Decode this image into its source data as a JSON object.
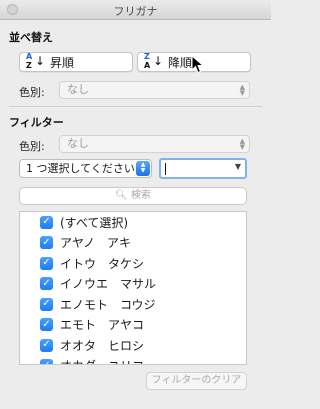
{
  "window": {
    "title": "フリガナ"
  },
  "sort": {
    "section_title": "並べ替え",
    "ascending_label": "昇順",
    "descending_label": "降順",
    "ascending_icon_top": "A",
    "ascending_icon_bottom": "Z",
    "descending_icon_top": "Z",
    "descending_icon_bottom": "A",
    "color_label": "色別:",
    "color_value": "なし"
  },
  "filter": {
    "section_title": "フィルター",
    "color_label": "色別:",
    "color_value": "なし",
    "condition_value": "1 つ選択してください",
    "value_input": "",
    "search_placeholder": "検索",
    "items": [
      {
        "label": "(すべて選択)",
        "checked": true
      },
      {
        "label": "アヤノ　アキ",
        "checked": true
      },
      {
        "label": "イトウ　タケシ",
        "checked": true
      },
      {
        "label": "イノウエ　マサル",
        "checked": true
      },
      {
        "label": "エノモト　コウジ",
        "checked": true
      },
      {
        "label": "エモト　アヤコ",
        "checked": true
      },
      {
        "label": "オオタ　ヒロシ",
        "checked": true
      },
      {
        "label": "オカダ　ユリコ",
        "checked": true
      }
    ],
    "clear_label": "フィルターのクリア"
  },
  "colors": {
    "accent": "#1d7cf2",
    "focus_ring": "#7fb3f5",
    "window_bg": "#ececec"
  }
}
